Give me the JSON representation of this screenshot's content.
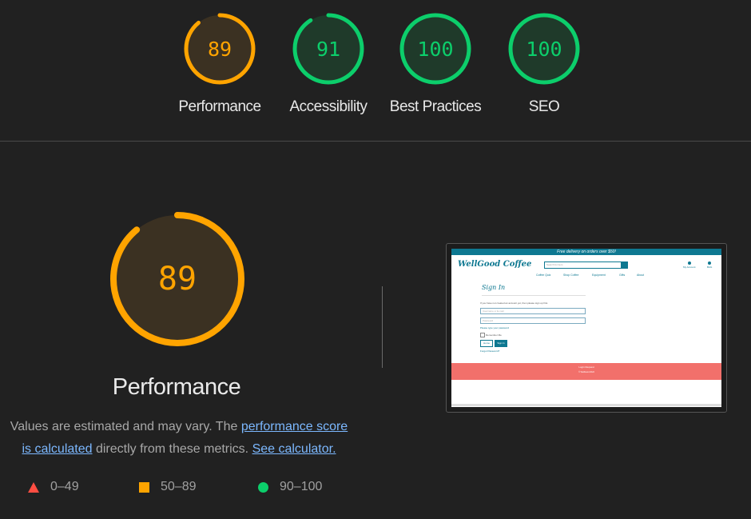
{
  "summary": {
    "gauges": [
      {
        "score": "89",
        "label": "Performance",
        "fraction": 0.89,
        "color": "#ffa400",
        "bg": "#3b3122"
      },
      {
        "score": "91",
        "label": "Accessibility",
        "fraction": 0.91,
        "color": "#0cce6b",
        "bg": "#1f3a2a"
      },
      {
        "score": "100",
        "label": "Best Practices",
        "fraction": 1.0,
        "color": "#0cce6b",
        "bg": "#1f3a2a"
      },
      {
        "score": "100",
        "label": "SEO",
        "fraction": 1.0,
        "color": "#0cce6b",
        "bg": "#1f3a2a"
      }
    ]
  },
  "main": {
    "score": "89",
    "fraction": 0.89,
    "color": "#ffa400",
    "bg": "#3b3122",
    "label": "Performance",
    "desc_prefix": "Values are estimated and may vary. The ",
    "desc_link1": "performance score is calculated",
    "desc_middle": " directly from these metrics. ",
    "desc_link2": "See calculator."
  },
  "legend": {
    "fail": {
      "range": "0–49",
      "icon": "triangle-icon",
      "color": "#ff4e42"
    },
    "average": {
      "range": "50–89",
      "icon": "square-icon",
      "color": "#ffa400"
    },
    "pass": {
      "range": "90–100",
      "icon": "circle-icon",
      "color": "#0cce6b"
    }
  },
  "screenshot": {
    "promo": "Free delivery on orders over $50!",
    "logo": "WellGood Coffee",
    "search_placeholder": "Search for item",
    "account": "My Account",
    "bag": "BAG",
    "nav": [
      "Coffee Quiz",
      "Shop Coffee",
      "Equipment",
      "Gifts",
      "About"
    ],
    "title": "Sign In",
    "intro": "If you have not created an account yet, then please sign up first.",
    "username_placeholder": "Username or E-mail",
    "password_placeholder": "Password",
    "password_hint": "Please type your password",
    "remember": "Remember Me",
    "home_button": "Home",
    "signin_button": "Sign In",
    "forgot": "Forgot Password?",
    "footer_social": "Login Request",
    "footer_copy": "© WellGood 2022"
  }
}
